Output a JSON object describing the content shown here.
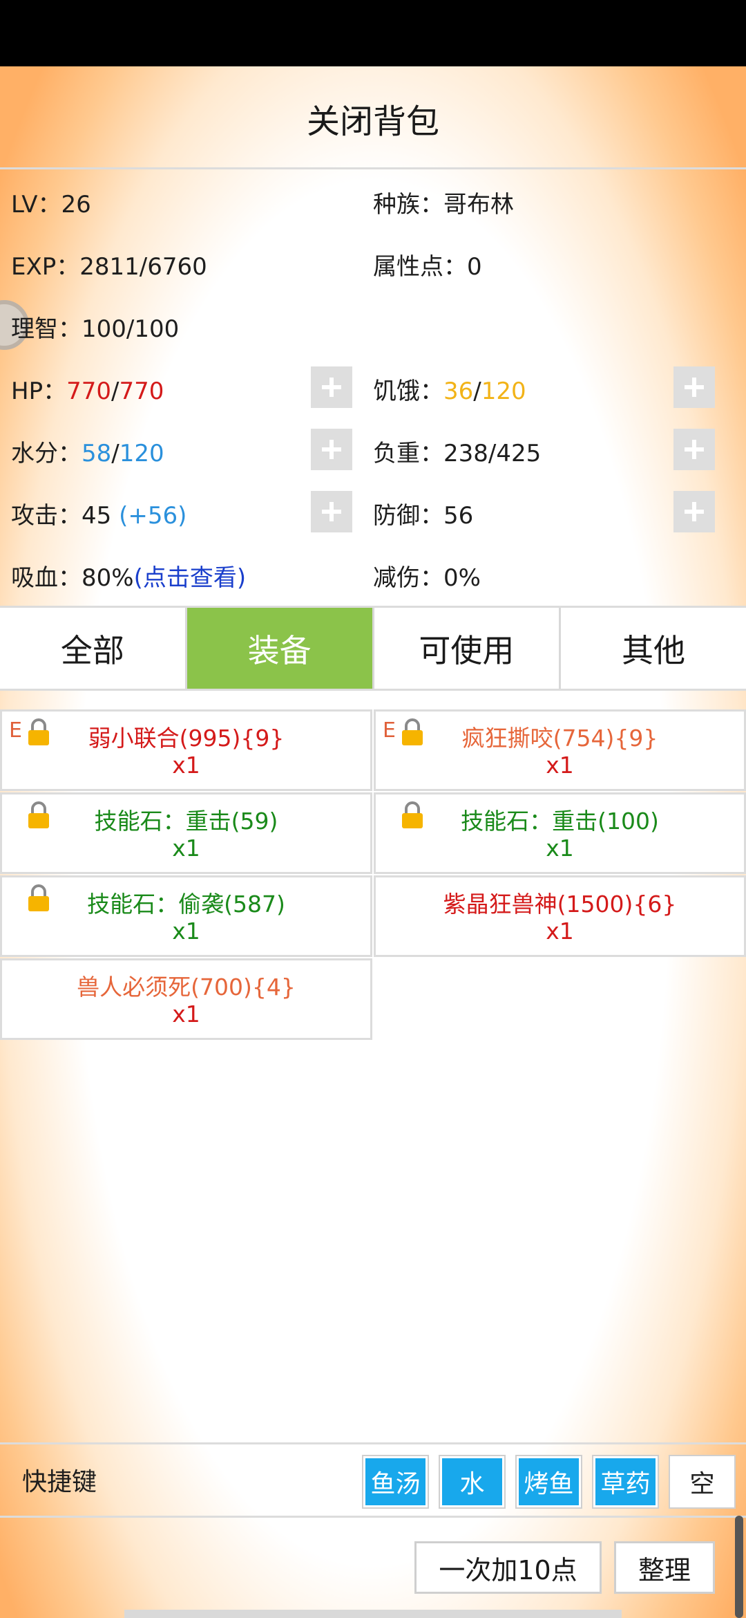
{
  "header": {
    "title": "关闭背包"
  },
  "stats": {
    "lv_label": "LV：",
    "lv_value": "26",
    "race_label": "种族：",
    "race_value": "哥布林",
    "exp_label": "EXP：",
    "exp_value": "2811/6760",
    "attr_label": "属性点：",
    "attr_value": "0",
    "sanity_label": "理智：",
    "sanity_value": "100/100",
    "hp_label": "HP：",
    "hp_cur": "770",
    "hp_sep": "/",
    "hp_max": "770",
    "hunger_label": "饥饿：",
    "hunger_cur": "36",
    "hunger_sep": "/",
    "hunger_max": "120",
    "water_label": "水分：",
    "water_cur": "58",
    "water_sep": "/",
    "water_max": "120",
    "load_label": "负重：",
    "load_value": "238/425",
    "atk_label": "攻击：",
    "atk_value": "45 ",
    "atk_bonus": "(+56)",
    "def_label": "防御：",
    "def_value": "56",
    "lifesteal_label": "吸血：",
    "lifesteal_value": "80%",
    "lifesteal_link": "(点击查看)",
    "reduce_label": "减伤：",
    "reduce_value": "0%"
  },
  "tabs": [
    "全部",
    "装备",
    "可使用",
    "其他"
  ],
  "items": [
    {
      "flag": "E",
      "name": "弱小联合(995){9}",
      "qty": "x1"
    },
    {
      "flag": "E",
      "name": "疯狂撕咬(754){9}",
      "qty": "x1"
    },
    {
      "flag": "",
      "name": "技能石：重击(59)",
      "qty": "x1"
    },
    {
      "flag": "",
      "name": "技能石：重击(100)",
      "qty": "x1"
    },
    {
      "flag": "",
      "name": "技能石：偷袭(587)",
      "qty": "x1"
    },
    {
      "flag": "",
      "name": "紫晶狂兽神(1500){6}",
      "qty": "x1"
    },
    {
      "flag": "",
      "name": "兽人必须死(700){4}",
      "qty": "x1"
    }
  ],
  "shortcuts": {
    "label": "快捷键",
    "slots": [
      "鱼汤",
      "水",
      "烤鱼",
      "草药",
      "空"
    ]
  },
  "actions": {
    "add10": "一次加10点",
    "sort": "整理"
  },
  "colors": {
    "active_tab": "#8bc34a",
    "shortcut_button": "#18a8ec",
    "hp": "#d41a1a",
    "hunger": "#f2b318",
    "water": "#2a90dc"
  },
  "icons": {
    "plus": "plus-icon",
    "lock": "lock-icon"
  }
}
